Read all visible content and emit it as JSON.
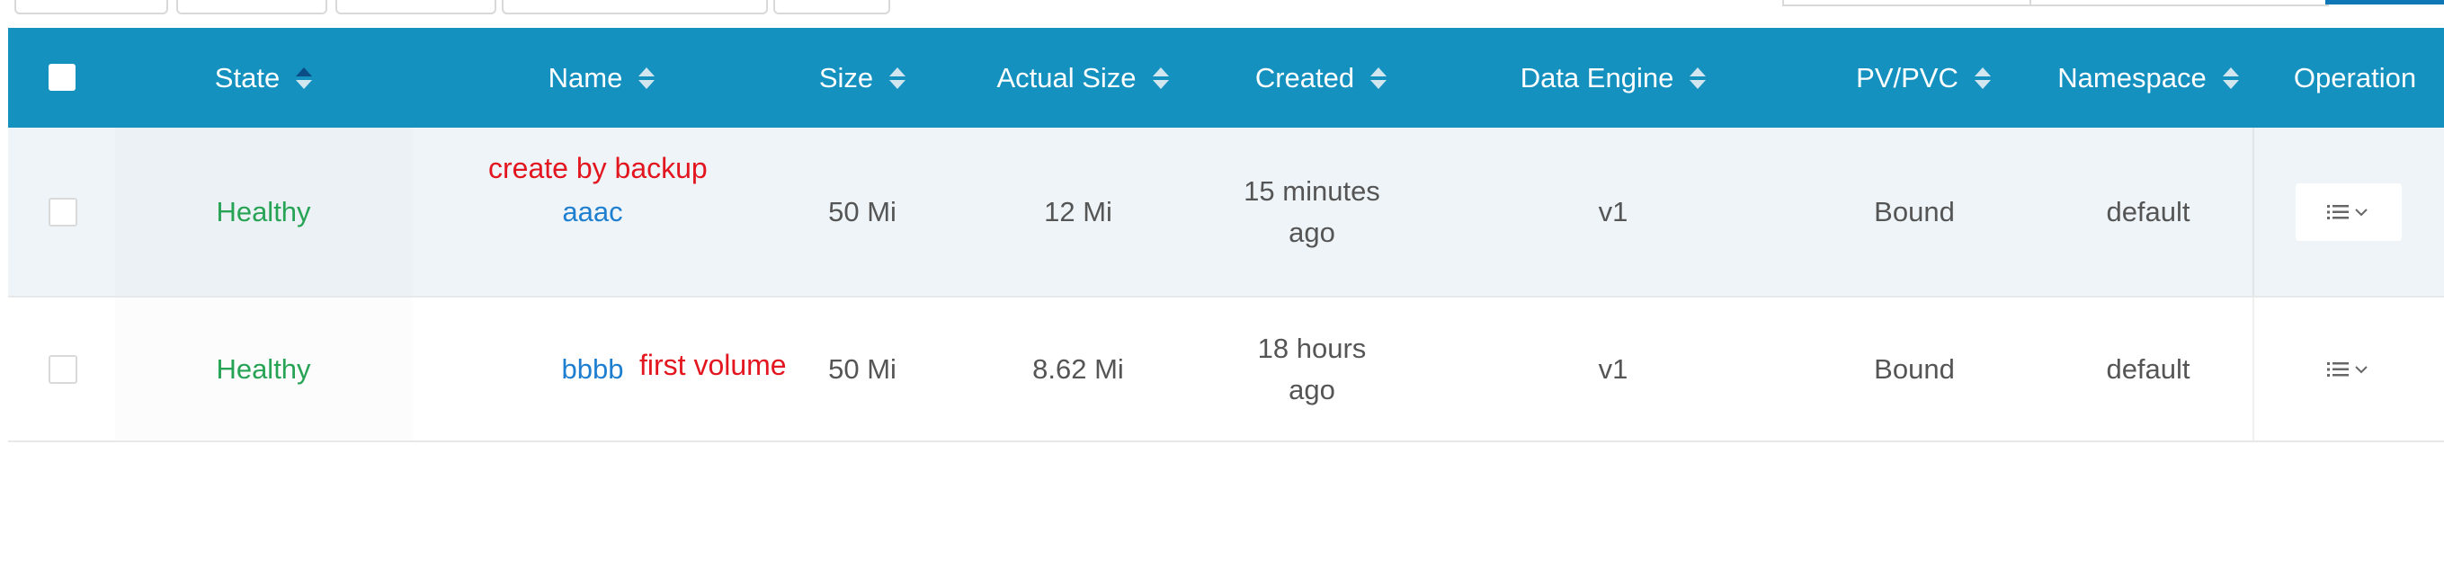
{
  "table": {
    "columns": {
      "state": "State",
      "name": "Name",
      "size": "Size",
      "actual_size": "Actual Size",
      "created": "Created",
      "data_engine": "Data Engine",
      "pv_pvc": "PV/PVC",
      "namespace": "Namespace",
      "operation": "Operation"
    },
    "sort": {
      "active_column": "state",
      "direction": "ascending"
    },
    "rows": [
      {
        "state": "Healthy",
        "name": "aaac",
        "annotation": "create by backup",
        "size": "50 Mi",
        "actual_size": "12 Mi",
        "created_line1": "15 minutes",
        "created_line2": "ago",
        "data_engine": "v1",
        "pv_pvc": "Bound",
        "namespace": "default",
        "operation_icon": "list-dropdown-icon"
      },
      {
        "state": "Healthy",
        "name": "bbbb",
        "annotation": "first volume",
        "size": "50 Mi",
        "actual_size": "8.62 Mi",
        "created_line1": "18 hours",
        "created_line2": "ago",
        "data_engine": "v1",
        "pv_pvc": "Bound",
        "namespace": "default",
        "operation_icon": "list-dropdown-icon"
      }
    ]
  },
  "colors": {
    "header_bg": "#1591c0",
    "healthy": "#27a355",
    "link": "#1e7fd0",
    "annotation": "#e3151f",
    "selected_row_bg": "#eef4f7"
  }
}
